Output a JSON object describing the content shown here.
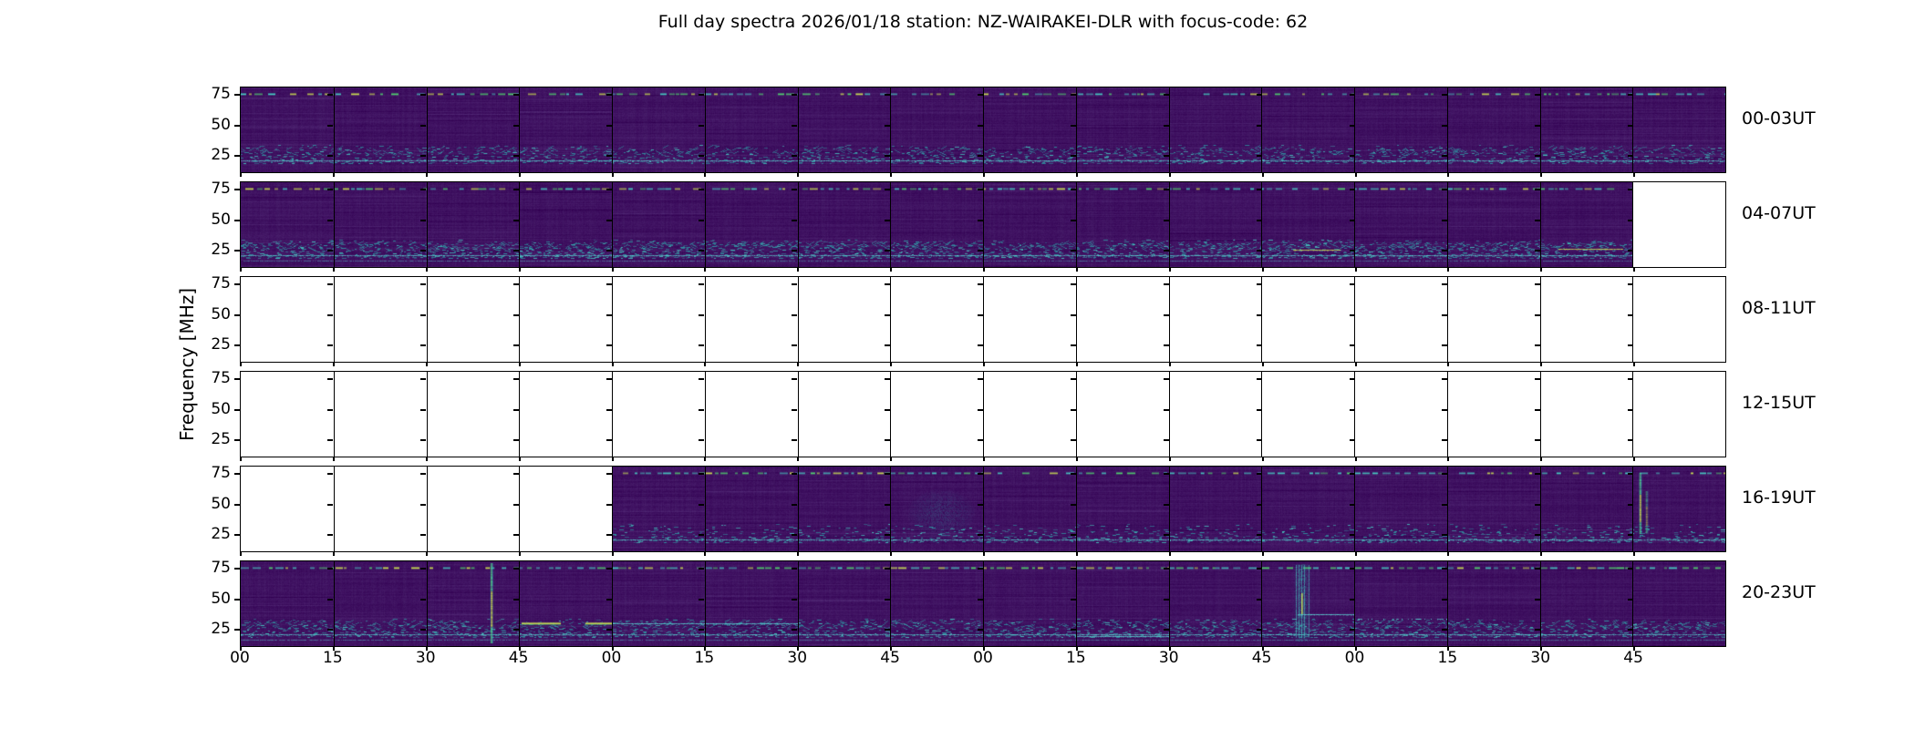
{
  "title": "Full day spectra 2026/01/18 station: NZ-WAIRAKEI-DLR with focus-code: 62",
  "axes": {
    "ylabel": "Frequency [MHz]",
    "y_tick_labels": [
      "75",
      "50",
      "25"
    ],
    "x_tick_labels": [
      "00",
      "15",
      "30",
      "45",
      "00",
      "15",
      "30",
      "45",
      "00",
      "15",
      "30",
      "45",
      "00",
      "15",
      "30",
      "45"
    ]
  },
  "colors": {
    "panel_base": "#3f1161",
    "stripe_light": "#4e1c74",
    "stripe_dark": "#2f094a",
    "teal": "#2da5aa",
    "bright_teal": "#46d7c8",
    "green": "#50dc6e",
    "yellow_green": "#cde450",
    "cyan_line": "#5ad2d2",
    "ink": "#000000"
  },
  "rows": [
    {
      "label": "00-03UT",
      "filled": [
        true,
        true,
        true,
        true,
        true,
        true,
        true,
        true,
        true,
        true,
        true,
        true,
        true,
        true,
        true,
        true
      ],
      "style": {
        "td": 0.5,
        "bd": 0.6,
        "zig": true,
        "line2": false
      },
      "features": []
    },
    {
      "label": "04-07UT",
      "filled": [
        true,
        true,
        true,
        true,
        true,
        true,
        true,
        true,
        true,
        true,
        true,
        true,
        true,
        true,
        true,
        false
      ],
      "style": {
        "td": 0.62,
        "bd": 0.9,
        "zig": true,
        "line2": true
      },
      "features": [
        {
          "panel": 12,
          "type": "hline",
          "y": 0.8,
          "x0": 0.35,
          "x1": 0.85,
          "color": "yellow"
        },
        {
          "panel": 15,
          "type": "hline",
          "y": 0.78,
          "x0": 0.2,
          "x1": 0.9,
          "color": "yellow"
        }
      ]
    },
    {
      "label": "08-11UT",
      "filled": [
        false,
        false,
        false,
        false,
        false,
        false,
        false,
        false,
        false,
        false,
        false,
        false,
        false,
        false,
        false,
        false
      ],
      "style": {
        "td": 0,
        "bd": 0,
        "zig": false,
        "line2": false
      },
      "features": []
    },
    {
      "label": "12-15UT",
      "filled": [
        false,
        false,
        false,
        false,
        false,
        false,
        false,
        false,
        false,
        false,
        false,
        false,
        false,
        false,
        false,
        false
      ],
      "style": {
        "td": 0,
        "bd": 0,
        "zig": false,
        "line2": false
      },
      "features": []
    },
    {
      "label": "16-19UT",
      "filled": [
        false,
        false,
        false,
        false,
        true,
        true,
        true,
        true,
        true,
        true,
        true,
        true,
        true,
        true,
        true,
        true
      ],
      "style": {
        "td": 0.55,
        "bd": 0.55,
        "zig": false,
        "line2": false
      },
      "features": [
        {
          "panel": 8,
          "type": "cloud",
          "cx": 0.55,
          "cy": 0.55,
          "rx": 0.38,
          "ry": 0.3
        },
        {
          "panel": 16,
          "type": "vline",
          "x": 0.08,
          "y0": 0.08,
          "y1": 0.8,
          "strong": true
        },
        {
          "panel": 16,
          "type": "vline",
          "x": 0.15,
          "y0": 0.3,
          "y1": 0.8,
          "strong": false
        }
      ]
    },
    {
      "label": "20-23UT",
      "filled": [
        true,
        true,
        true,
        true,
        true,
        true,
        true,
        true,
        true,
        true,
        true,
        true,
        true,
        true,
        true,
        true
      ],
      "style": {
        "td": 0.7,
        "bd": 0.75,
        "zig": true,
        "line2": true
      },
      "features": [
        {
          "panel": 3,
          "type": "vline",
          "x": 0.7,
          "y0": 0.03,
          "y1": 0.97,
          "strong": true
        },
        {
          "panel": 4,
          "type": "dashes",
          "y": 0.73,
          "segs": [
            [
              0.03,
              0.45
            ],
            [
              0.72,
              1.0
            ]
          ]
        },
        {
          "panel": 5,
          "type": "hline",
          "y": 0.73,
          "x0": 0.0,
          "x1": 1.0,
          "color": "cyan"
        },
        {
          "panel": 6,
          "type": "hline",
          "y": 0.73,
          "x0": 0.0,
          "x1": 1.0,
          "color": "cyan"
        },
        {
          "panel": 10,
          "type": "hline",
          "y": 0.88,
          "x0": 0.0,
          "x1": 1.0,
          "color": "cyan"
        },
        {
          "panel": 12,
          "type": "burst",
          "x": 0.44
        },
        {
          "panel": 12,
          "type": "hline",
          "y": 0.62,
          "x0": 0.4,
          "x1": 1.0,
          "color": "cyan"
        },
        {
          "panel": 13,
          "type": "hline",
          "y": 0.68,
          "x0": 0.0,
          "x1": 1.0,
          "color": "cyan",
          "dash": true
        }
      ]
    }
  ],
  "chart_data": {
    "type": "heatmap",
    "subtype": "radio-spectrogram-grid",
    "title": "Full day spectra 2026/01/18 station: NZ-WAIRAKEI-DLR with focus-code: 62",
    "ylabel": "Frequency [MHz]",
    "y_ticks_mhz": [
      75,
      50,
      25
    ],
    "y_range_mhz_approx": [
      11,
      81
    ],
    "x_tick_labels_minutes": [
      "00",
      "15",
      "30",
      "45",
      "00",
      "15",
      "30",
      "45",
      "00",
      "15",
      "30",
      "45",
      "00",
      "15",
      "30",
      "45"
    ],
    "panels_per_row": 16,
    "minutes_per_panel": 15,
    "rows": [
      {
        "label": "00-03UT",
        "panels_with_data": "all 16"
      },
      {
        "label": "04-07UT",
        "panels_with_data": "first 15; last panel empty"
      },
      {
        "label": "08-11UT",
        "panels_with_data": "none (all empty)"
      },
      {
        "label": "12-15UT",
        "panels_with_data": "none (all empty)"
      },
      {
        "label": "16-19UT",
        "panels_with_data": "panels 5-16; first 4 empty"
      },
      {
        "label": "20-23UT",
        "panels_with_data": "all 16"
      }
    ],
    "notable_features": [
      "bright dashed interference band near 76 MHz along top of every filled panel",
      "dense teal speckle band near 20-30 MHz plus continuous cyan line near 17 MHz",
      "strong full-height yellow-green burst at ~20:41 UT (row 20-23UT, panel 3)",
      "broad cyan vertical burst cluster at ~22:50 UT (row 20-23UT, panel 12)",
      "diffuse teal enhancement mid-band in row 16-19UT panel 8",
      "narrow vertical burst near start of last panel of row 16-19UT",
      "bright yellow-green horizontal segments near 25 MHz in row 20-23UT panels 4-6",
      "legend: none; grid: none; colormap: viridis-like purple/teal/yellow"
    ],
    "legend_position": "none",
    "grid": false
  }
}
